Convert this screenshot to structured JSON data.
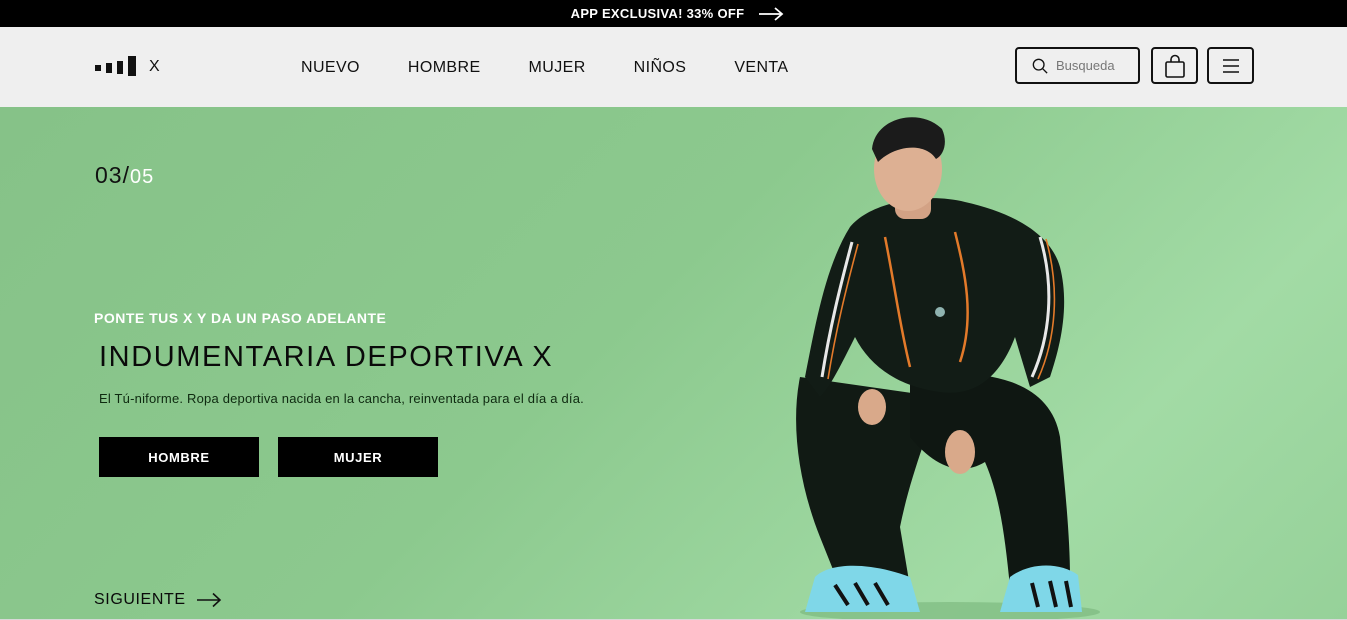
{
  "promo": {
    "text": "APP EXCLUSIVA! 33% OFF",
    "arrow_icon": "arrow-right-icon"
  },
  "header": {
    "logo_text": "X",
    "nav": [
      {
        "label": "NUEVO"
      },
      {
        "label": "HOMBRE"
      },
      {
        "label": "MUJER"
      },
      {
        "label": "NIÑOS"
      },
      {
        "label": "VENTA"
      }
    ],
    "search": {
      "placeholder": "Busqueda",
      "value": "",
      "icon": "search-icon"
    },
    "cart_icon": "shopping-bag-icon",
    "menu_icon": "hamburger-menu-icon"
  },
  "hero": {
    "counter_current": "03",
    "counter_separator": "/",
    "counter_total": "05",
    "eyebrow": "PONTE TUS X Y DA UN PASO ADELANTE",
    "headline": "INDUMENTARIA DEPORTIVA X",
    "description": "El Tú-niforme. Ropa deportiva nacida en la cancha, reinventada para el día a día.",
    "buttons": [
      {
        "label": "HOMBRE"
      },
      {
        "label": "MUJER"
      }
    ],
    "next_label": "SIGUIENTE",
    "background_color": "#8cc98e",
    "image": "model-photo"
  },
  "colors": {
    "promo_bg": "#000000",
    "header_bg": "#efefef",
    "accent_green": "#8cc98e",
    "button_bg": "#000000"
  }
}
